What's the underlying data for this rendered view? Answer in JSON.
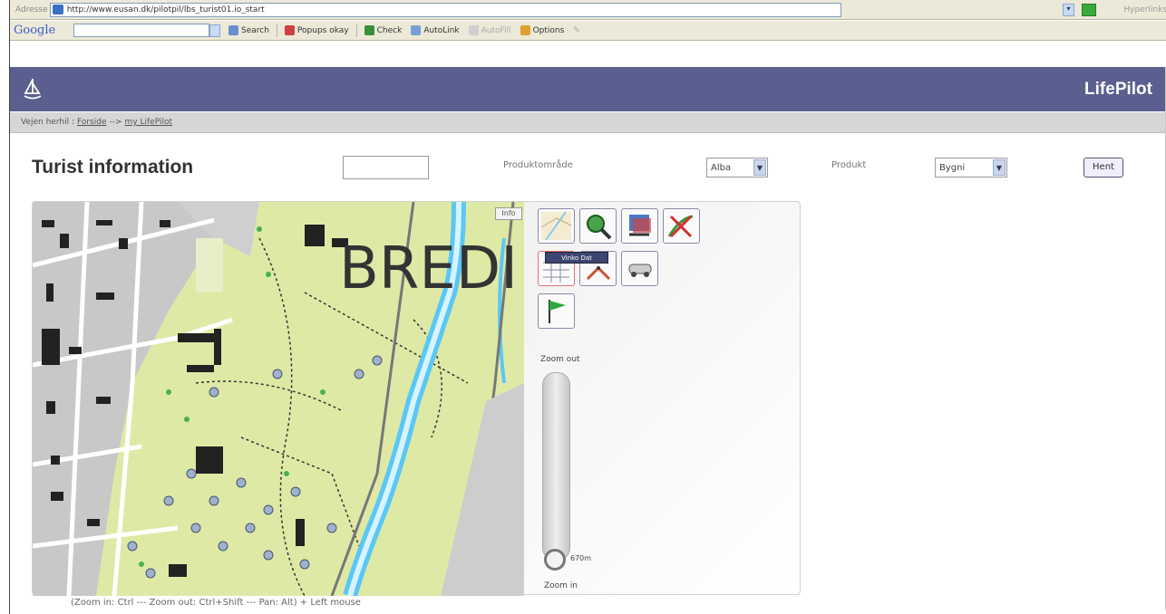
{
  "browser": {
    "address_label": "Adresse",
    "url": "http://www.eusan.dk/pilotpil/lbs_turist01.io_start",
    "links_label": "Hyperlinks",
    "google_label": "Google",
    "toolbar": {
      "search_label": "Search",
      "popups_label": "Popups okay",
      "check_label": "Check",
      "autolink_label": "AutoLink",
      "autofill_label": "AutoFill",
      "options_label": "Options"
    }
  },
  "header": {
    "brand": "LifePilot",
    "logo_icon": "sailboat-icon",
    "brand_color": "#5a5f8f"
  },
  "breadcrumb": {
    "prefix": "Vejen herhil :",
    "home": "Forside",
    "sep": "-->",
    "current": "my LifePilot"
  },
  "page": {
    "title": "Turist information",
    "search_value": "",
    "product_area_label": "Produktområde",
    "product_area_value": "Alba",
    "product_label": "Produkt",
    "product_value": "Bygni",
    "fetch_button": "Hent"
  },
  "map": {
    "info_label": "Info",
    "place_text": "BREDI",
    "tools": [
      {
        "name": "overview-map-icon"
      },
      {
        "name": "zoom-to-extent-icon"
      },
      {
        "name": "map-layers-icon"
      },
      {
        "name": "clear-selection-icon"
      },
      {
        "name": "legend-table-icon"
      },
      {
        "name": "measure-distance-icon"
      },
      {
        "name": "route-car-icon"
      },
      {
        "name": "green-flag-icon"
      }
    ],
    "tooltip": "Vinko Dat",
    "zoom_out_label": "Zoom out",
    "zoom_in_label": "Zoom in",
    "scale_label": "670m",
    "zoom_level": 0.95,
    "help_text": "(Zoom in: Ctrl --- Zoom out: Ctrl+Shift --- Pan: Alt) + Left mouse"
  }
}
